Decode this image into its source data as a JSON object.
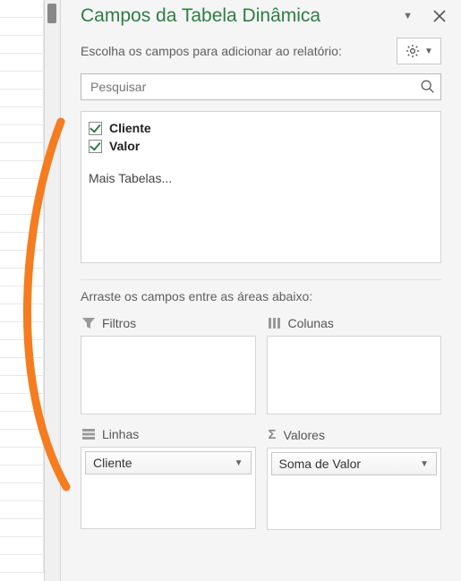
{
  "pane": {
    "title": "Campos da Tabela Dinâmica",
    "prompt_add": "Escolha os campos para adicionar ao relatório:",
    "search_placeholder": "Pesquisar",
    "more_tables": "Mais Tabelas...",
    "drag_prompt": "Arraste os campos entre as áreas abaixo:"
  },
  "fields": [
    {
      "name": "Cliente",
      "checked": true
    },
    {
      "name": "Valor",
      "checked": true
    }
  ],
  "areas": {
    "filters": {
      "label": "Filtros",
      "items": []
    },
    "columns": {
      "label": "Colunas",
      "items": []
    },
    "rows": {
      "label": "Linhas",
      "items": [
        "Cliente"
      ]
    },
    "values": {
      "label": "Valores",
      "items": [
        "Soma de Valor"
      ]
    }
  },
  "colors": {
    "accent": "#2e7d44",
    "annotation": "#f57c1f"
  }
}
